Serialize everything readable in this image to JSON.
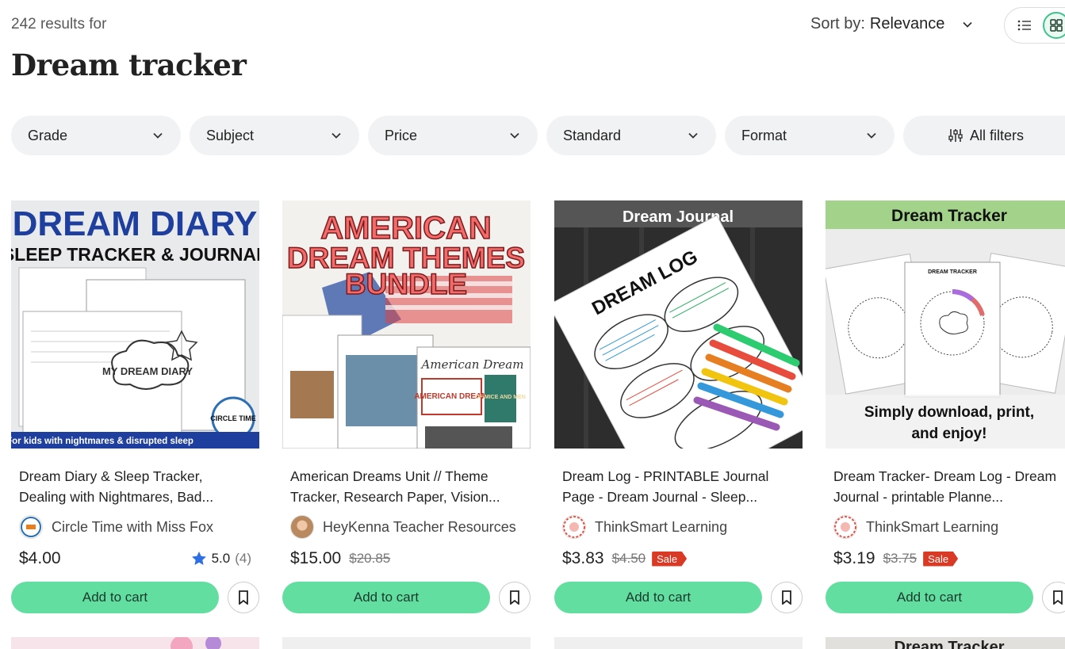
{
  "header": {
    "results_count": "242 results for",
    "title": "Dream tracker"
  },
  "sort": {
    "label": "Sort by:",
    "value": "Relevance"
  },
  "view_toggle": {
    "options": [
      "list-view-icon",
      "grid-view-icon"
    ],
    "active": "grid-view-icon"
  },
  "filters": [
    {
      "label": "Grade"
    },
    {
      "label": "Subject"
    },
    {
      "label": "Price"
    },
    {
      "label": "Standard"
    },
    {
      "label": "Format"
    },
    {
      "label": "All filters"
    }
  ],
  "colors": {
    "accent_green": "#62dea1",
    "sale_red": "#d93a25",
    "star_blue": "#2f6fe4",
    "filter_bg": "#f1f2f3"
  },
  "products": [
    {
      "title": "Dream Diary & Sleep Tracker, Dealing with Nightmares, Bad...",
      "seller": "Circle Time with Miss Fox",
      "price": "$4.00",
      "old_price": "",
      "sale": "",
      "rating": "5.0",
      "rating_count": "(4)",
      "cta": "Add to cart",
      "thumb": {
        "line1": "DREAM DIARY",
        "line2": "SLEEP TRACKER & JOURNAL",
        "center": "MY DREAM DIARY",
        "badge": "CIRCLE TIME",
        "footer": "For kids with nightmares & disrupted sleep"
      }
    },
    {
      "title": "American Dreams Unit // Theme Tracker, Research Paper, Vision...",
      "seller": "HeyKenna Teacher Resources",
      "price": "$15.00",
      "old_price": "$20.85",
      "sale": "",
      "rating": "",
      "rating_count": "",
      "cta": "Add to cart",
      "thumb": {
        "line1": "AMERICAN",
        "line2": "DREAM THEMES",
        "line3": "BUNDLE",
        "label_a": "American Dream",
        "label_b": "AMERICAN DREAM",
        "label_c": "OF MICE AND MEN"
      }
    },
    {
      "title": "Dream Log - PRINTABLE Journal Page - Dream Journal - Sleep...",
      "seller": "ThinkSmart Learning",
      "price": "$3.83",
      "old_price": "$4.50",
      "sale": "Sale",
      "rating": "",
      "rating_count": "",
      "cta": "Add to cart",
      "thumb": {
        "banner": "Dream Journal",
        "heading": "DREAM LOG"
      }
    },
    {
      "title": "Dream Tracker- Dream Log - Dream Journal - printable Planne...",
      "seller": "ThinkSmart Learning",
      "price": "$3.19",
      "old_price": "$3.75",
      "sale": "Sale",
      "rating": "",
      "rating_count": "",
      "cta": "Add to cart",
      "thumb": {
        "banner": "Dream Tracker",
        "sheet": "DREAM TRACKER",
        "footer1": "Simply download, print,",
        "footer2": "and enjoy!"
      }
    }
  ],
  "next_row": {
    "partial_label": "Dream Tracker"
  }
}
